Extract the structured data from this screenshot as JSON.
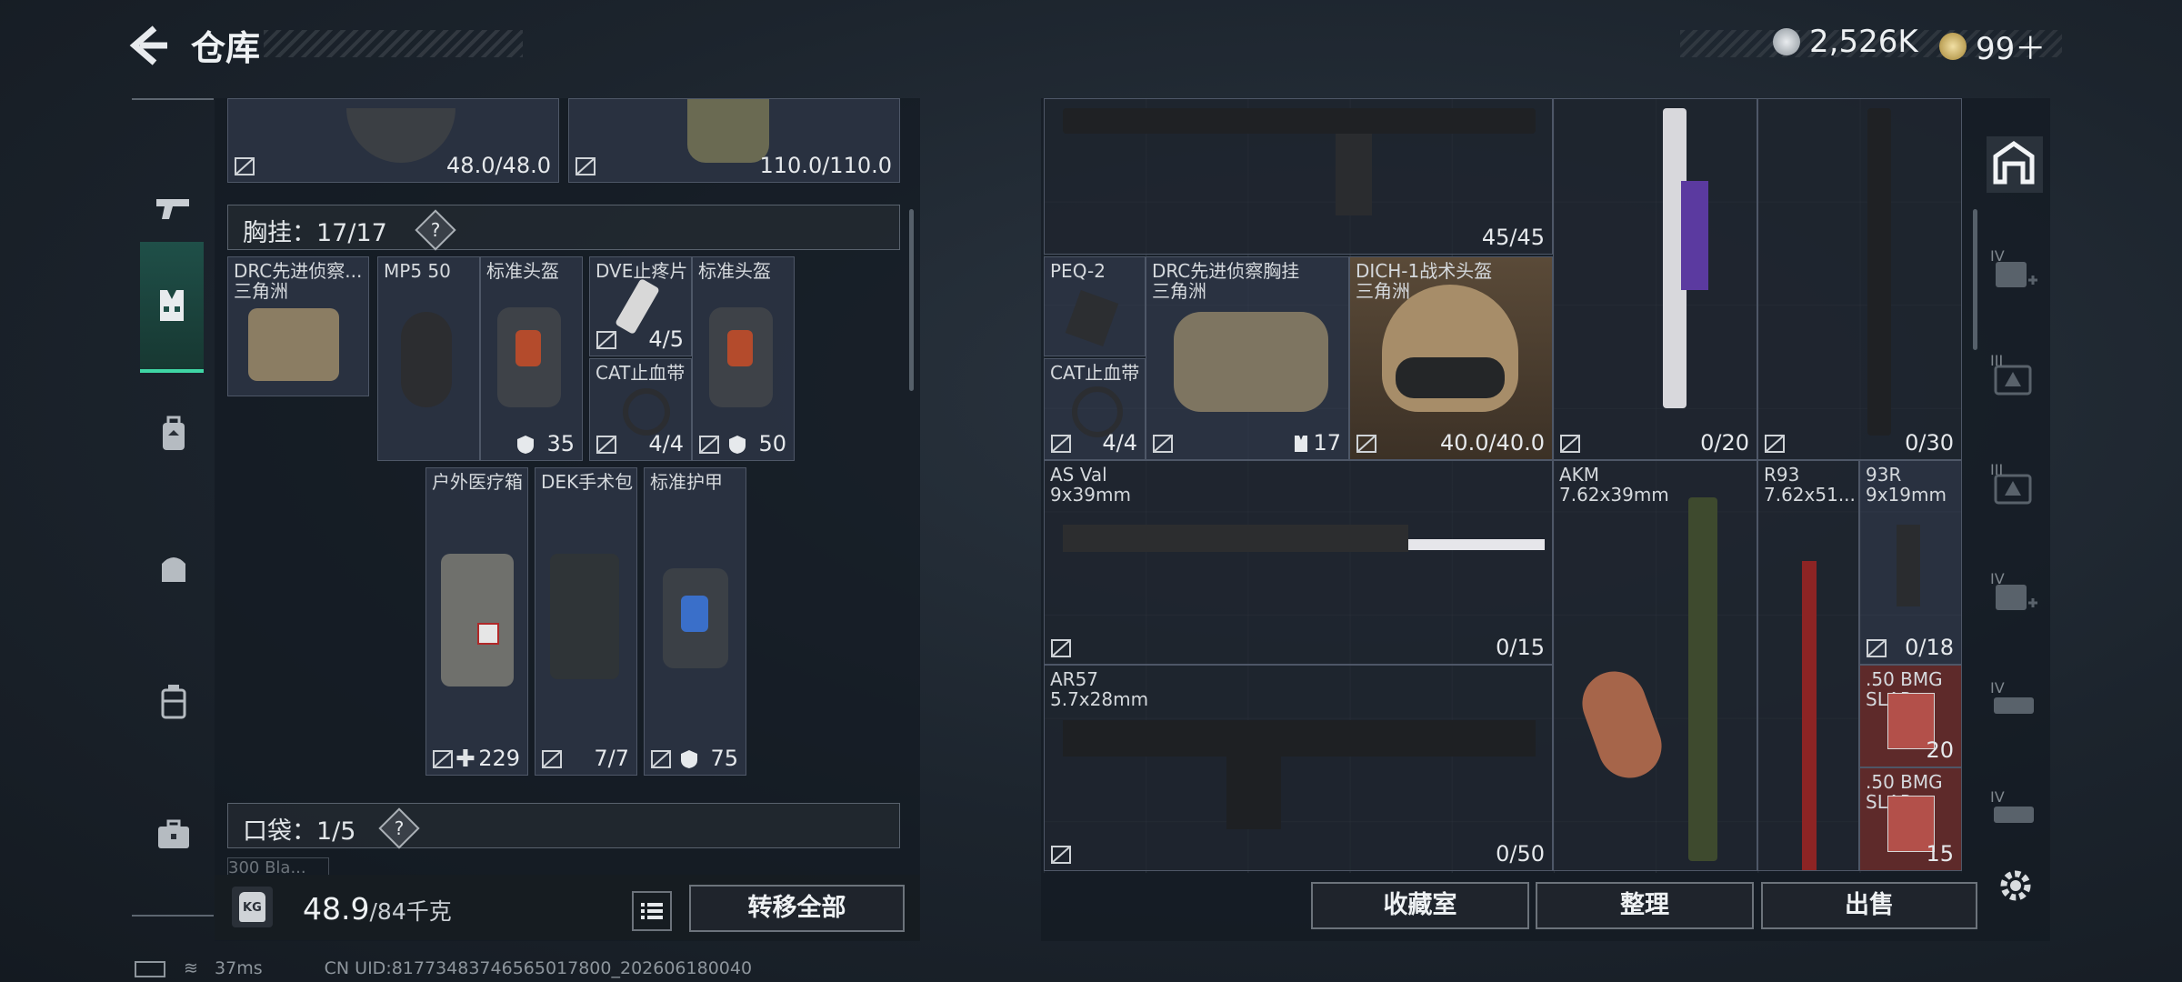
{
  "header": {
    "title": "仓库"
  },
  "currency": [
    {
      "icon": "silver-coin-icon",
      "value": "2,526K"
    },
    {
      "icon": "gold-coin-icon",
      "value": "99＋"
    }
  ],
  "nav": [
    {
      "icon": "pistol-icon"
    },
    {
      "icon": "chest-rig-icon"
    },
    {
      "icon": "backpack-icon"
    },
    {
      "icon": "bag-icon"
    },
    {
      "icon": "case-icon"
    },
    {
      "icon": "briefcase-icon"
    }
  ],
  "left": {
    "top_items": [
      {
        "value": "48.0/48.0"
      },
      {
        "value": "110.0/110.0"
      }
    ],
    "chest_rig_label": "胸挂：17/17",
    "chest_rig_help": "?",
    "rig": {
      "name": "DRC先进侦察...",
      "sub": "三角洲"
    },
    "slots": [
      {
        "name": "MP5 50",
        "count": ""
      },
      {
        "name": "标准头盔",
        "count": "35"
      },
      {
        "name": "DVE止疼片",
        "count": "4/5"
      },
      {
        "name": "CAT止血带",
        "count": "4/4"
      },
      {
        "name": "标准头盔",
        "count": "50"
      },
      {
        "name": "户外医疗箱",
        "count": "229"
      },
      {
        "name": "DEK手术包",
        "count": "7/7"
      },
      {
        "name": "标准护甲",
        "count": "75"
      }
    ],
    "pocket_label": "口袋：1/5",
    "pocket_help": "?",
    "pocket_peek": "300 Bla..."
  },
  "footer": {
    "weight_current": "48.9",
    "weight_max": "/84千克",
    "kg_badge": "KG",
    "transfer_all": "转移全部"
  },
  "right": {
    "items": [
      {
        "name": "",
        "count": "45/45"
      },
      {
        "name": "PEQ-2",
        "count": ""
      },
      {
        "name": "CAT止血带",
        "count": "4/4"
      },
      {
        "name": "DRC先进侦察胸挂",
        "sub": "三角洲",
        "count": "17"
      },
      {
        "name": "DICH-1战术头盔",
        "sub": "三角洲",
        "count": "40.0/40.0"
      },
      {
        "name": "",
        "count": "0/20"
      },
      {
        "name": "",
        "count": "0/30"
      },
      {
        "name": "AS Val",
        "sub": "9x39mm",
        "count": "0/15"
      },
      {
        "name": "AKM",
        "sub": "7.62x39mm",
        "count": ""
      },
      {
        "name": "R93",
        "sub": "7.62x51...",
        "count": ""
      },
      {
        "name": "93R",
        "sub": "9x19mm",
        "count": "0/18"
      },
      {
        "name": "AR57",
        "sub": "5.7x28mm",
        "count": "0/50"
      },
      {
        "name": ".50 BMG",
        "sub": "SLAP",
        "count": "20"
      },
      {
        "name": ".50 BMG",
        "sub": "SLAP",
        "count": "15"
      }
    ],
    "buttons": {
      "collection": "收藏室",
      "sort": "整理",
      "sell": "出售"
    },
    "side_tabs": [
      "IV",
      "III",
      "III",
      "IV",
      "IV",
      "IV"
    ]
  },
  "status": {
    "ping": "37ms",
    "uid": "CN UID:81773483746565017800_202606180040"
  },
  "colors": {
    "accent": "#3fd6a5",
    "panel": "#30384a",
    "highlight": "#5a4a38",
    "ammo_red": "#5e2a2a"
  }
}
